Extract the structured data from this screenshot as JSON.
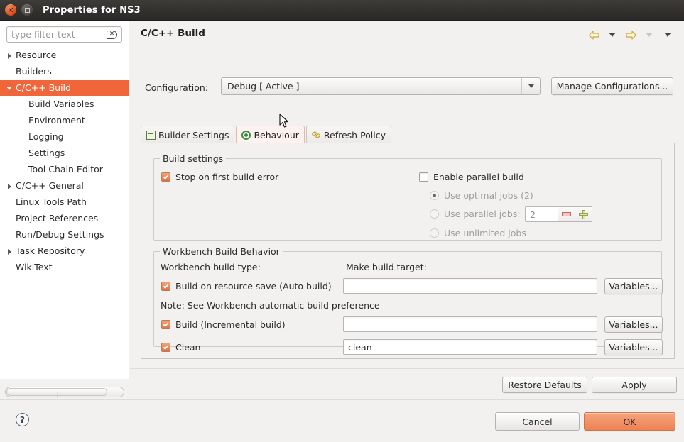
{
  "window": {
    "title": "Properties for NS3",
    "close_icon": "close-icon",
    "maximize_icon": "maximize-icon"
  },
  "sidebar": {
    "filter": {
      "placeholder": "type filter text",
      "value": "",
      "clear_icon": "clear-icon"
    },
    "items": [
      {
        "label": "Resource",
        "indent": false,
        "arrow": "right",
        "selected": false
      },
      {
        "label": "Builders",
        "indent": false,
        "arrow": "none",
        "selected": false
      },
      {
        "label": "C/C++ Build",
        "indent": false,
        "arrow": "down",
        "selected": true
      },
      {
        "label": "Build Variables",
        "indent": true,
        "arrow": "none",
        "selected": false
      },
      {
        "label": "Environment",
        "indent": true,
        "arrow": "none",
        "selected": false
      },
      {
        "label": "Logging",
        "indent": true,
        "arrow": "none",
        "selected": false
      },
      {
        "label": "Settings",
        "indent": true,
        "arrow": "none",
        "selected": false
      },
      {
        "label": "Tool Chain Editor",
        "indent": true,
        "arrow": "none",
        "selected": false
      },
      {
        "label": "C/C++ General",
        "indent": false,
        "arrow": "right",
        "selected": false
      },
      {
        "label": "Linux Tools Path",
        "indent": false,
        "arrow": "none",
        "selected": false
      },
      {
        "label": "Project References",
        "indent": false,
        "arrow": "none",
        "selected": false
      },
      {
        "label": "Run/Debug Settings",
        "indent": false,
        "arrow": "none",
        "selected": false
      },
      {
        "label": "Task Repository",
        "indent": false,
        "arrow": "right",
        "selected": false
      },
      {
        "label": "WikiText",
        "indent": false,
        "arrow": "none",
        "selected": false
      }
    ]
  },
  "page": {
    "title": "C/C++ Build",
    "nav": {
      "back_icon": "back-arrow-icon",
      "back_menu_icon": "chevron-down-icon",
      "forward_icon": "forward-arrow-icon",
      "forward_menu_icon": "chevron-down-icon",
      "menu_icon": "chevron-down-icon"
    }
  },
  "configuration": {
    "label": "Configuration:",
    "value": "Debug  [ Active ]",
    "dropdown_icon": "chevron-down-icon",
    "manage_button": "Manage Configurations..."
  },
  "tabs": [
    {
      "label": "Builder Settings",
      "icon": "builder-settings-icon",
      "active": false
    },
    {
      "label": "Behaviour",
      "icon": "behaviour-icon",
      "active": true
    },
    {
      "label": "Refresh Policy",
      "icon": "refresh-policy-icon",
      "active": false
    }
  ],
  "build_settings": {
    "title": "Build settings",
    "stop_on_first_error": {
      "label": "Stop on first build error",
      "checked": true
    },
    "enable_parallel_build": {
      "label": "Enable parallel build",
      "checked": false
    },
    "radios": [
      {
        "label": "Use optimal jobs (2)",
        "selected": true,
        "enabled": false
      },
      {
        "label": "Use parallel jobs:",
        "selected": false,
        "enabled": false
      },
      {
        "label": "Use unlimited jobs",
        "selected": false,
        "enabled": false
      }
    ],
    "jobs_spinner": {
      "value": "2",
      "decrement_icon": "minus-icon",
      "increment_icon": "plus-icon"
    }
  },
  "workbench_build_behavior": {
    "title": "Workbench Build Behavior",
    "build_type_label": "Workbench build type:",
    "make_target_label": "Make build target:",
    "note": "Note: See Workbench automatic build preference",
    "rows": [
      {
        "label": "Build on resource save (Auto build)",
        "checked": true,
        "target": "",
        "button": "Variables..."
      },
      {
        "label": "Build (Incremental build)",
        "checked": true,
        "target": "",
        "button": "Variables..."
      },
      {
        "label": "Clean",
        "checked": true,
        "target": "clean",
        "button": "Variables..."
      }
    ]
  },
  "actions": {
    "restore_defaults": "Restore Defaults",
    "apply": "Apply",
    "cancel": "Cancel",
    "ok": "OK",
    "help_icon": "help-icon",
    "help_glyph": "?"
  },
  "colors": {
    "selection": "#f0663a",
    "accent_ok": "#ef8253",
    "checkbox": "#e4713f",
    "titlebar": "#32302e"
  }
}
